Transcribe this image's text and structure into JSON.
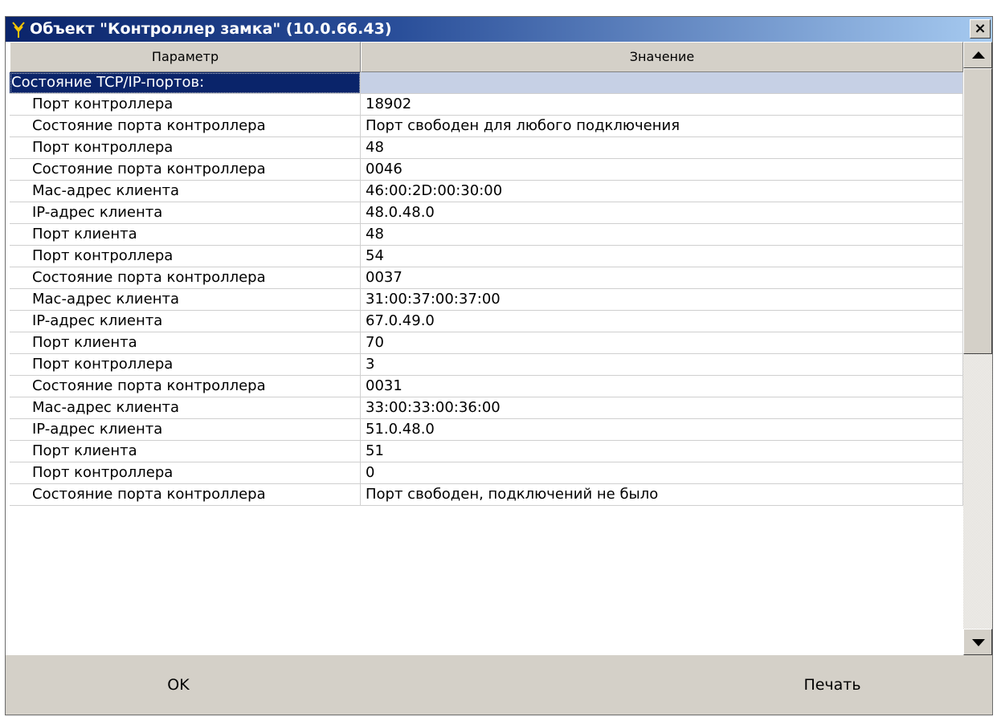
{
  "window": {
    "title": "Объект \"Контроллер замка\" (10.0.66.43)",
    "close_label": "×",
    "icon": "antenna-icon"
  },
  "table": {
    "headers": {
      "param": "Параметр",
      "value": "Значение"
    },
    "group_label": "Состояние TCP/IP-портов:",
    "rows": [
      {
        "param": "Порт контроллера",
        "value": "18902"
      },
      {
        "param": "Состояние порта контроллера",
        "value": "Порт свободен для любого подключения"
      },
      {
        "param": "Порт контроллера",
        "value": "48"
      },
      {
        "param": "Состояние порта контроллера",
        "value": "0046"
      },
      {
        "param": "Мас-адрес клиента",
        "value": "46:00:2D:00:30:00"
      },
      {
        "param": "IP-адрес клиента",
        "value": "48.0.48.0"
      },
      {
        "param": "Порт клиента",
        "value": "48"
      },
      {
        "param": "Порт контроллера",
        "value": "54"
      },
      {
        "param": "Состояние порта контроллера",
        "value": "0037"
      },
      {
        "param": "Мас-адрес клиента",
        "value": "31:00:37:00:37:00"
      },
      {
        "param": "IP-адрес клиента",
        "value": "67.0.49.0"
      },
      {
        "param": "Порт клиента",
        "value": "70"
      },
      {
        "param": "Порт контроллера",
        "value": "3"
      },
      {
        "param": "Состояние порта контроллера",
        "value": "0031"
      },
      {
        "param": "Мас-адрес клиента",
        "value": "33:00:33:00:36:00"
      },
      {
        "param": "IP-адрес клиента",
        "value": "51.0.48.0"
      },
      {
        "param": "Порт клиента",
        "value": "51"
      },
      {
        "param": "Порт контроллера",
        "value": "0"
      },
      {
        "param": "Состояние порта контроллера",
        "value": "Порт свободен, подключений не было"
      }
    ]
  },
  "buttons": {
    "ok": "OK",
    "print": "Печать"
  },
  "colors": {
    "title_start": "#0a246a",
    "title_end": "#a6caf0",
    "group_bg": "#0a246a",
    "group_value_bg": "#c6d0e5",
    "face": "#d4d0c8"
  }
}
